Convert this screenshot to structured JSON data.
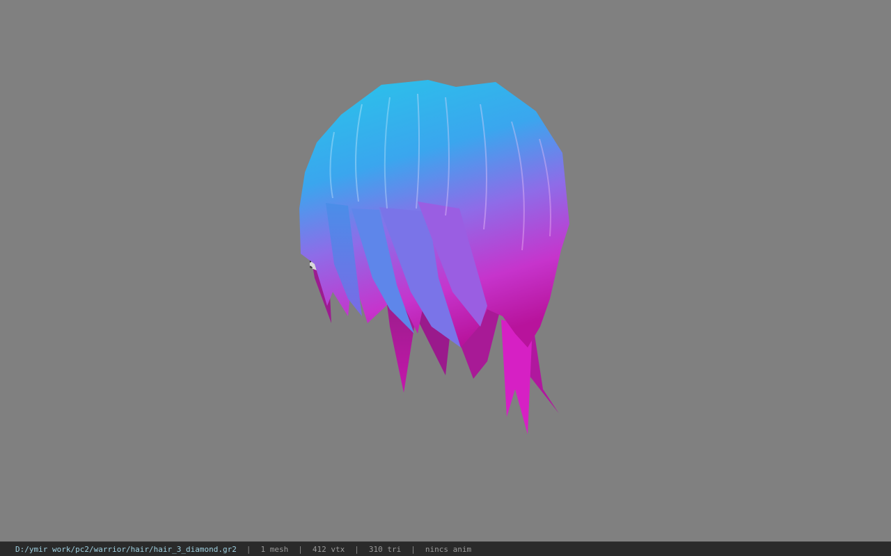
{
  "status_bar": {
    "file_path": "D:/ymir work/pc2/warrior/hair/hair_3_diamond.gr2",
    "separator": "|",
    "mesh_count": "1 mesh",
    "vertex_count": "412 vtx",
    "triangle_count": "310 tri",
    "animation_status": "nincs anim"
  },
  "colors": {
    "background": "#808080",
    "status_bar_bg": "#2a2a2a",
    "path_text": "#9fd0e0",
    "info_text": "#9a9a9a",
    "hair_top": "#2fb4e6",
    "hair_mid": "#8a6ae8",
    "hair_bottom": "#d41ec8"
  }
}
